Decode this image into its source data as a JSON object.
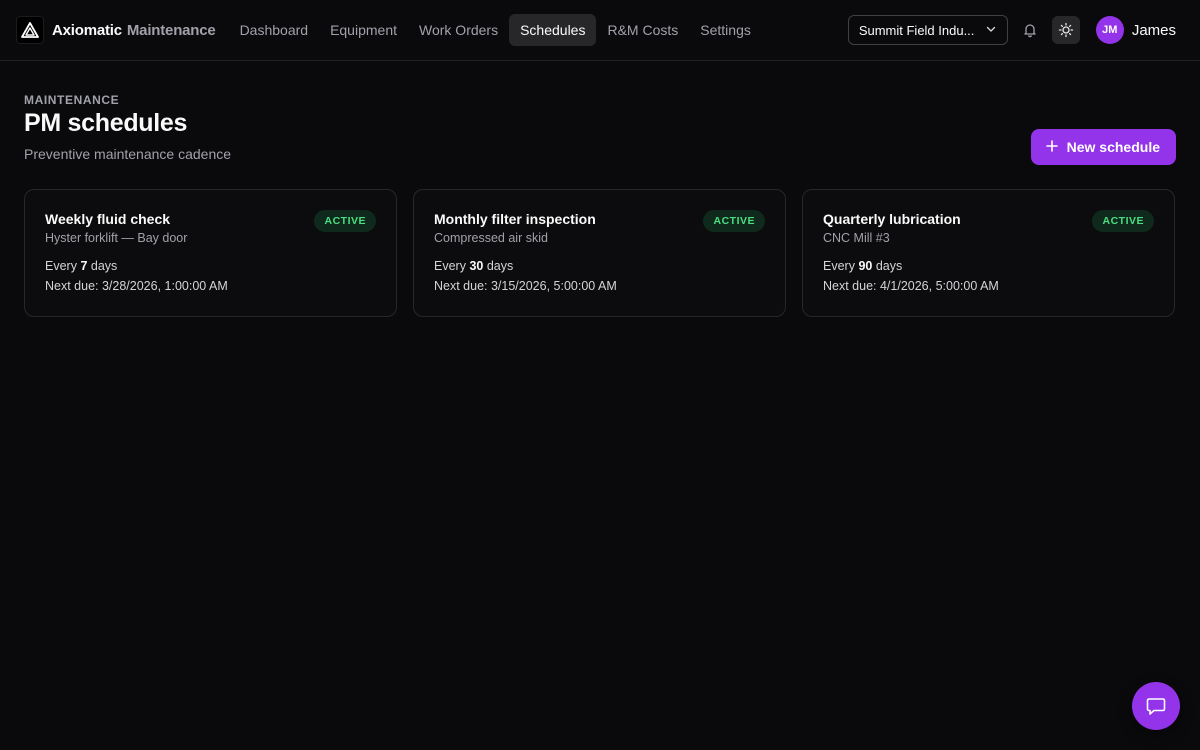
{
  "app": {
    "brand_name": "Axiomatic",
    "brand_sub": "Maintenance"
  },
  "nav": [
    {
      "label": "Dashboard",
      "active": false
    },
    {
      "label": "Equipment",
      "active": false
    },
    {
      "label": "Work Orders",
      "active": false
    },
    {
      "label": "Schedules",
      "active": true
    },
    {
      "label": "R&M Costs",
      "active": false
    },
    {
      "label": "Settings",
      "active": false
    }
  ],
  "org_select": {
    "value": "Summit Field Indu..."
  },
  "user": {
    "initials": "JM",
    "name": "James"
  },
  "header": {
    "eyebrow": "MAINTENANCE",
    "title": "PM schedules",
    "subtitle": "Preventive maintenance cadence",
    "new_button": "New schedule"
  },
  "schedules": [
    {
      "title": "Weekly fluid check",
      "asset": "Hyster forklift — Bay door",
      "status": "ACTIVE",
      "every_prefix": "Every",
      "interval": "7",
      "every_suffix": "days",
      "next_due": "Next due: 3/28/2026, 1:00:00 AM"
    },
    {
      "title": "Monthly filter inspection",
      "asset": "Compressed air skid",
      "status": "ACTIVE",
      "every_prefix": "Every",
      "interval": "30",
      "every_suffix": "days",
      "next_due": "Next due: 3/15/2026, 5:00:00 AM"
    },
    {
      "title": "Quarterly lubrication",
      "asset": "CNC Mill #3",
      "status": "ACTIVE",
      "every_prefix": "Every",
      "interval": "90",
      "every_suffix": "days",
      "next_due": "Next due: 4/1/2026, 5:00:00 AM"
    }
  ],
  "colors": {
    "accent": "#9333ea",
    "active_badge_text": "#4ade80",
    "active_badge_bg": "#0f2a1c",
    "background": "#0a0a0c"
  },
  "icons": {
    "logo": "triangle-logo-icon",
    "org_chevron": "chevron-down-icon",
    "bell": "bell-icon",
    "theme": "sun-icon",
    "new": "plus-icon",
    "chat": "chat-icon"
  }
}
